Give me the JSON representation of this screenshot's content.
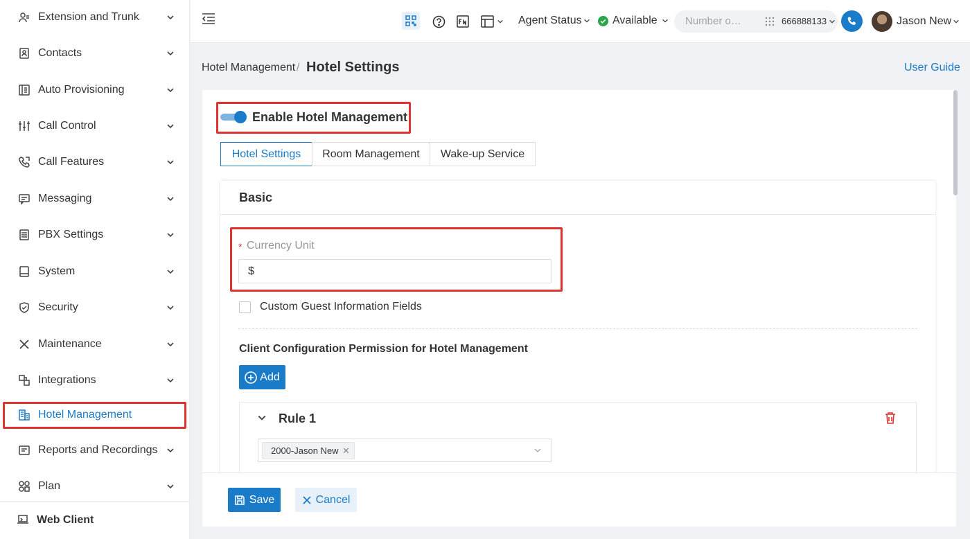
{
  "colors": {
    "accent": "#1a7bc9",
    "highlight": "#e0322e",
    "success": "#2aa54a"
  },
  "sidebar": {
    "items": [
      {
        "label": "Extension and Trunk",
        "icon": "user-list-icon"
      },
      {
        "label": "Contacts",
        "icon": "contacts-book-icon"
      },
      {
        "label": "Auto Provisioning",
        "icon": "provisioning-icon"
      },
      {
        "label": "Call Control",
        "icon": "sliders-icon"
      },
      {
        "label": "Call Features",
        "icon": "phone-features-icon"
      },
      {
        "label": "Messaging",
        "icon": "message-icon"
      },
      {
        "label": "PBX Settings",
        "icon": "pbx-settings-icon"
      },
      {
        "label": "System",
        "icon": "monitor-icon"
      },
      {
        "label": "Security",
        "icon": "shield-icon"
      },
      {
        "label": "Maintenance",
        "icon": "tools-icon"
      },
      {
        "label": "Integrations",
        "icon": "integrations-icon"
      },
      {
        "label": "Hotel Management",
        "icon": "hotel-icon",
        "active": true
      },
      {
        "label": "Reports and Recordings",
        "icon": "reports-icon"
      },
      {
        "label": "Plan",
        "icon": "plan-icon"
      }
    ],
    "web_client": "Web Client"
  },
  "header": {
    "agent_status": "Agent Status",
    "availability": "Available",
    "search_placeholder": "Number o…",
    "extension": "666888133",
    "user_name": "Jason New"
  },
  "breadcrumb": {
    "parent": "Hotel Management",
    "separator": "/",
    "current": "Hotel Settings"
  },
  "user_guide": "User Guide",
  "main": {
    "enable_label": "Enable Hotel Management",
    "enabled": true,
    "tabs": [
      {
        "label": "Hotel Settings",
        "active": true
      },
      {
        "label": "Room Management"
      },
      {
        "label": "Wake-up Service"
      }
    ],
    "section_title": "Basic",
    "currency": {
      "required_mark": "*",
      "label": "Currency Unit",
      "value": "$"
    },
    "custom_guest_fields": {
      "label": "Custom Guest Information Fields",
      "checked": false
    },
    "permission_title": "Client Configuration Permission for Hotel Management",
    "add_label": "Add",
    "rule": {
      "title": "Rule 1",
      "selected": [
        "2000-Jason New"
      ]
    }
  },
  "footer": {
    "save_label": "Save",
    "cancel_label": "Cancel"
  }
}
